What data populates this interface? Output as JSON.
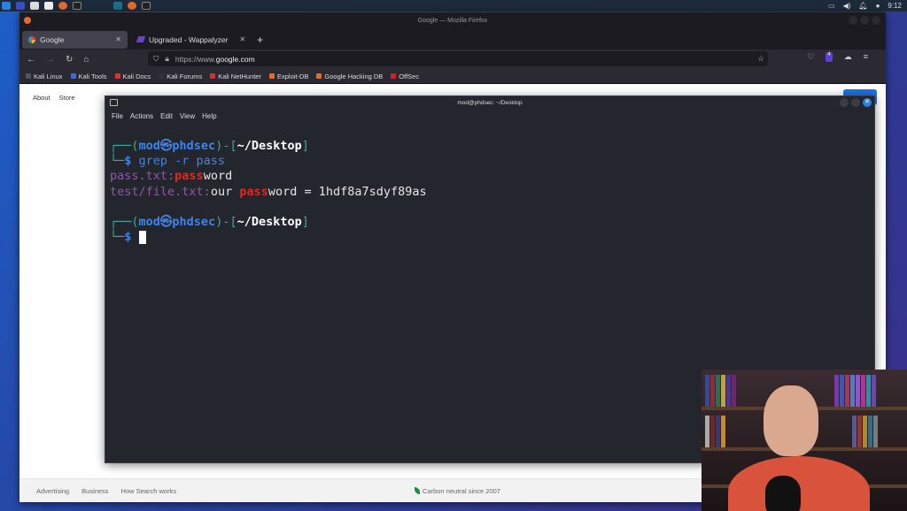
{
  "taskbar": {
    "time": "9:12",
    "icons": [
      "kali-menu-icon",
      "desktop-icon",
      "files-icon",
      "text-editor-icon",
      "firefox-icon",
      "terminal-icon"
    ]
  },
  "browser": {
    "window_title": "Google — Mozilla Firefox",
    "tabs": [
      {
        "label": "Google",
        "active": true
      },
      {
        "label": "Upgraded - Wappalyzer",
        "active": false
      }
    ],
    "url_prefix": "https://www.",
    "url_domain": "google.com",
    "extension_badge": "4",
    "bookmarks": [
      {
        "label": "Kali Linux",
        "color": "#555"
      },
      {
        "label": "Kali Tools",
        "color": "#3a6fd8"
      },
      {
        "label": "Kali Docs",
        "color": "#d33"
      },
      {
        "label": "Kali Forums",
        "color": "#333"
      },
      {
        "label": "Kali NetHunter",
        "color": "#c33"
      },
      {
        "label": "Exploit-DB",
        "color": "#e86a1c"
      },
      {
        "label": "Google Hacking DB",
        "color": "#e86a1c"
      },
      {
        "label": "OffSec",
        "color": "#c22"
      }
    ]
  },
  "google": {
    "top_links": [
      "About",
      "Store"
    ],
    "footer_links": [
      "Advertising",
      "Business",
      "How Search works"
    ],
    "carbon": "Carbon neutral since 2007"
  },
  "terminal": {
    "title": "mod@phdsec: ~/Desktop",
    "menu": [
      "File",
      "Actions",
      "Edit",
      "View",
      "Help"
    ],
    "user": "mod",
    "host": "phdsec",
    "cwd": "~/Desktop",
    "command": "grep -r pass",
    "results": [
      {
        "file": "pass.txt",
        "pre": "",
        "match": "pass",
        "post": "word"
      },
      {
        "file": "test/file.txt",
        "pre": "our ",
        "match": "pass",
        "post": "word = 1hdf8a7sdyf89as"
      }
    ]
  }
}
